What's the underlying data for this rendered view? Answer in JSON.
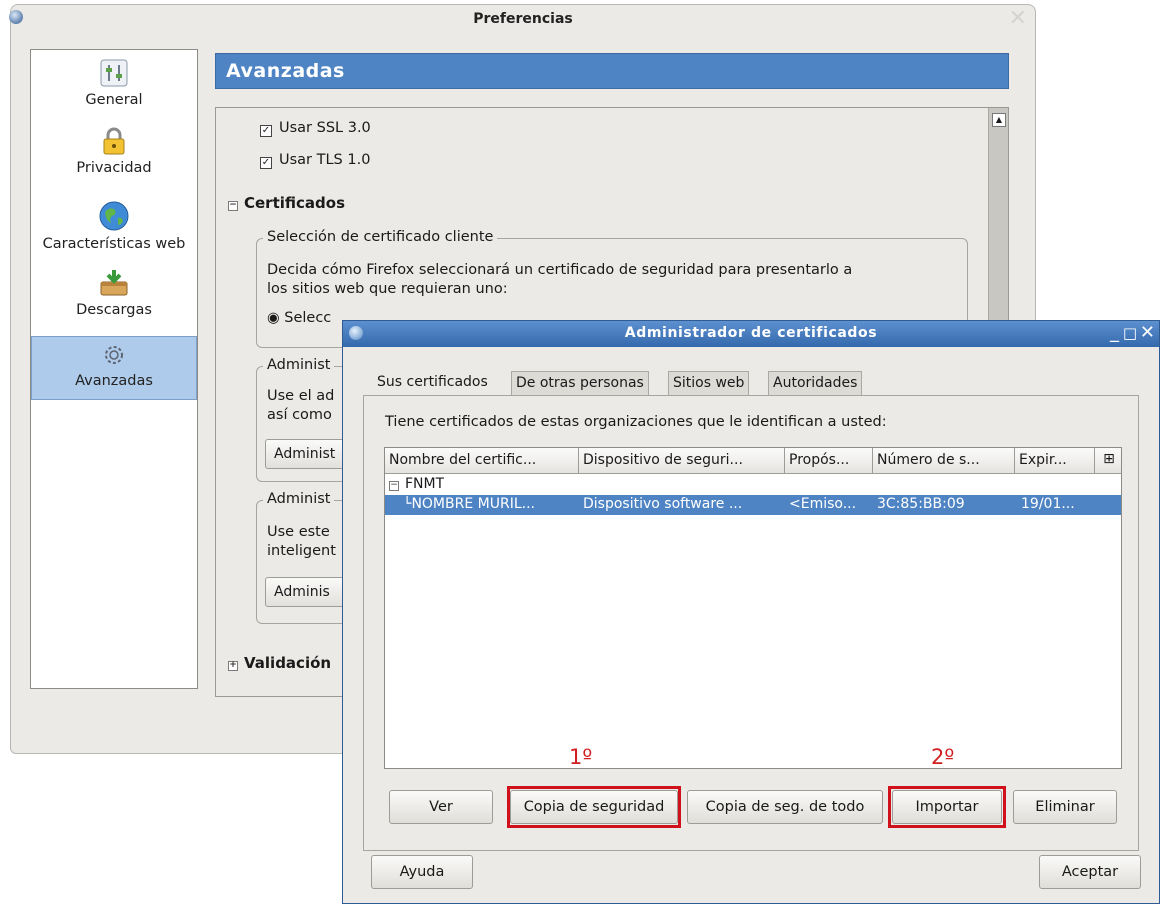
{
  "preferences": {
    "title": "Preferencias",
    "sidebar": [
      {
        "label": "General",
        "icon": "general-icon"
      },
      {
        "label": "Privacidad",
        "icon": "lock-icon"
      },
      {
        "label": "Características web",
        "icon": "globe-icon"
      },
      {
        "label": "Descargas",
        "icon": "download-icon"
      },
      {
        "label": "Avanzadas",
        "icon": "gear-icon",
        "selected": true
      }
    ],
    "section_title": "Avanzadas",
    "ssl_label": "Usar SSL 3.0",
    "tls_label": "Usar TLS 1.0",
    "certs_heading": "Certificados",
    "client_cert_group": "Selección de certificado cliente",
    "client_cert_desc_1": "Decida cómo Firefox seleccionará un certificado de seguridad para presentarlo a",
    "client_cert_desc_2": "los sitios web que requieran uno:",
    "radio_select_label": "Selecc",
    "admin_group_1": "Administ",
    "admin_desc_1a": "Use el ad",
    "admin_desc_1b": "así como",
    "admin_button_1": "Administ",
    "admin_group_2": "Administ",
    "admin_desc_2a": "Use este",
    "admin_desc_2b": "inteligent",
    "admin_button_2": "Adminis",
    "validation_heading": "Validación"
  },
  "cert_manager": {
    "title": "Administrador de certificados",
    "tabs": [
      "Sus certificados",
      "De otras personas",
      "Sitios web",
      "Autoridades"
    ],
    "active_tab": 0,
    "description": "Tiene certificados de estas organizaciones que le identifican a usted:",
    "columns": [
      "Nombre del certific...",
      "Dispositivo de seguri...",
      "Propós...",
      "Número de s...",
      "Expir..."
    ],
    "group": "FNMT",
    "rows": [
      {
        "name": "NOMBRE MURIL...",
        "device": "Dispositivo software ...",
        "purpose": "<Emiso...",
        "serial": "3C:85:BB:09",
        "expires": "19/01..."
      }
    ],
    "annotation_1": "1º",
    "annotation_2": "2º",
    "buttons": {
      "view": "Ver",
      "backup": "Copia de seguridad",
      "backup_all": "Copia de seg. de todo",
      "import": "Importar",
      "delete": "Eliminar",
      "help": "Ayuda",
      "accept": "Aceptar"
    }
  },
  "colors": {
    "accent": "#4f84c4",
    "highlight": "#d0101a"
  }
}
